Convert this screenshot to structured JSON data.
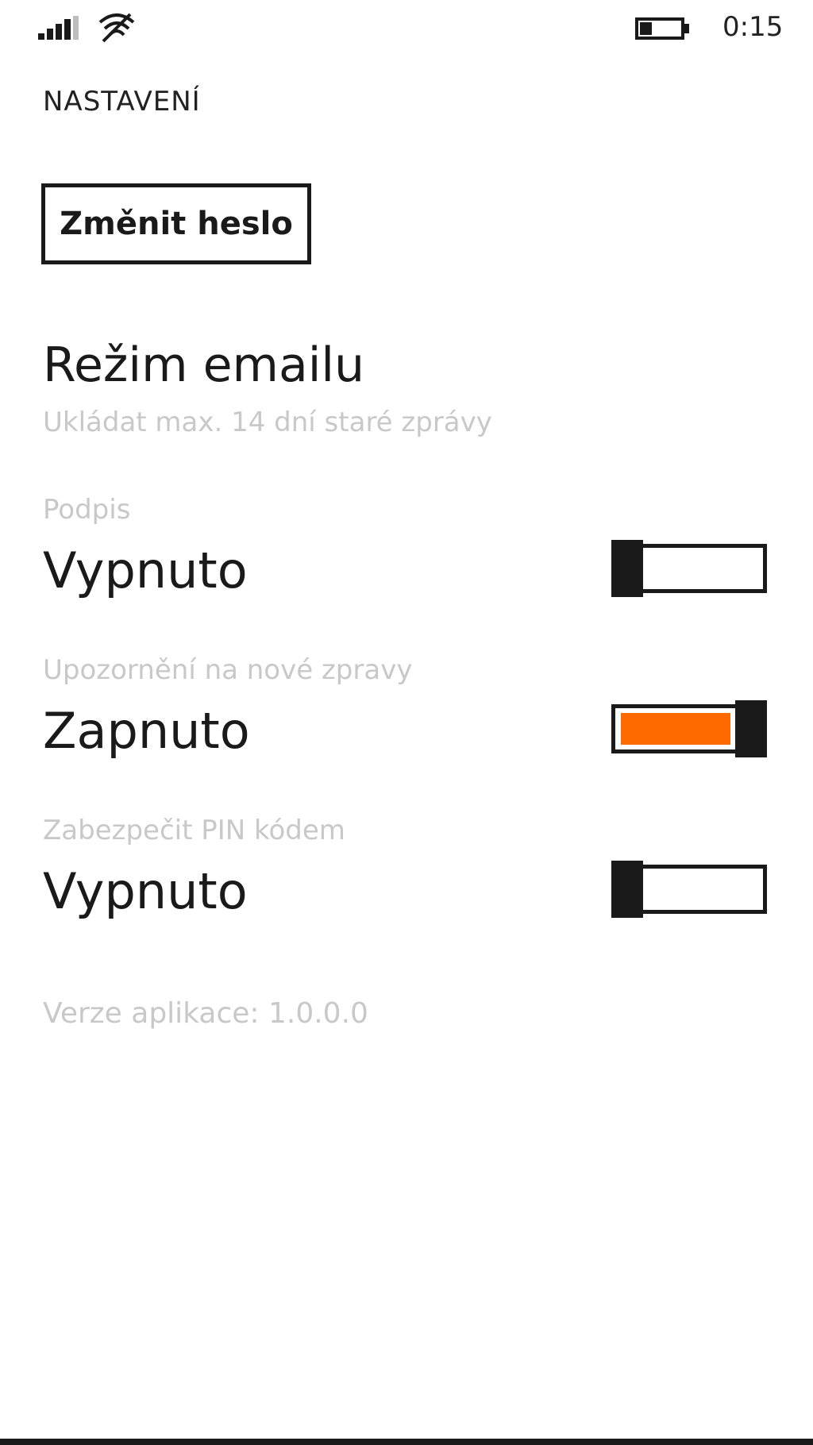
{
  "status_bar": {
    "time": "0:15",
    "signal_icon": "signal-strength-icon",
    "wifi_icon": "wifi-icon",
    "battery_icon": "battery-icon",
    "battery_level": 0.3
  },
  "page": {
    "title": "NASTAVENÍ"
  },
  "actions": {
    "change_password_label": "Změnit heslo"
  },
  "email_mode": {
    "title": "Režim emailu",
    "subtitle": "Ukládat max. 14 dní staré zprávy"
  },
  "settings": [
    {
      "label": "Podpis",
      "value": "Vypnuto",
      "on": false
    },
    {
      "label": "Upozornění na nové zpravy",
      "value": "Zapnuto",
      "on": true
    },
    {
      "label": "Zabezpečit PIN kódem",
      "value": "Vypnuto",
      "on": false
    }
  ],
  "footer": {
    "version": "Verze aplikace: 1.0.0.0"
  },
  "colors": {
    "accent": "#ff6a00",
    "text": "#1a1a1a",
    "secondary_text": "#c8c8c8",
    "background": "#ffffff"
  }
}
